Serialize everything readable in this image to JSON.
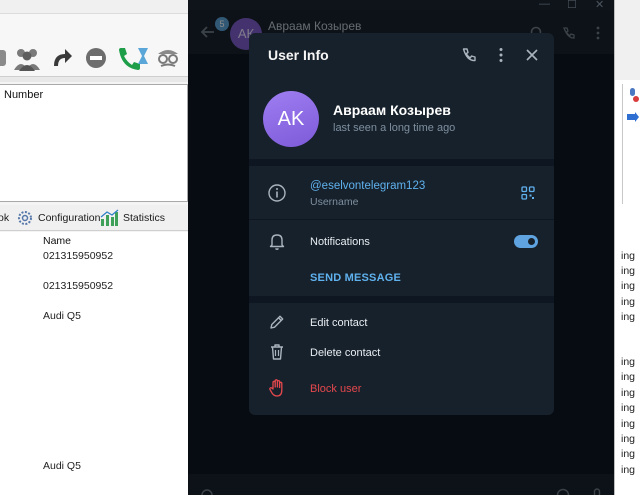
{
  "background_app": {
    "panel_label": "Number",
    "tabs": [
      {
        "label": "ok"
      },
      {
        "label": "Configuration"
      },
      {
        "label": "Statistics"
      }
    ],
    "list": {
      "column_name": "Name",
      "rows": [
        "021315950952",
        "021315950952",
        "Audi Q5",
        "Audi Q5"
      ]
    },
    "right_edge_text": "ing"
  },
  "telegram": {
    "header": {
      "name": "Авраам Козырев",
      "avatar_initials": "АК",
      "unread_badge": "5"
    },
    "user_info": {
      "title": "User Info",
      "avatar_initials": "AK",
      "name": "Авраам Козырев",
      "last_seen": "last seen a long time ago",
      "username": "@eselvontelegram123",
      "username_label": "Username",
      "notifications_label": "Notifications",
      "notifications_enabled": true,
      "send_message": "SEND MESSAGE",
      "edit_contact": "Edit contact",
      "delete_contact": "Delete contact",
      "block_user": "Block user"
    }
  },
  "colors": {
    "dialog_bg": "#17212b",
    "chat_bg": "#0e1621",
    "accent_blue": "#5fb1ee",
    "danger_red": "#e5484d",
    "avatar_purple": "#8b6ae6"
  }
}
